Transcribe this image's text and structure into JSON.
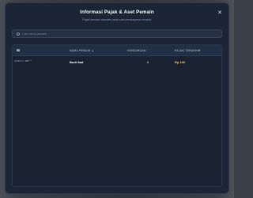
{
  "modal": {
    "title": "Informasi Pajak & Aset Pemain",
    "subtitle": "Pajak tercatat otomatis pada saat pembayaran terakhir"
  },
  "search": {
    "placeholder": "Cari nama pemain..."
  },
  "table": {
    "headers": {
      "name": "NAMA PEMAIN ▲",
      "vehicles": "KENDARAAN",
      "last_tax": "PAJAK TERAKHIR"
    },
    "rows": [
      {
        "id": "char1:a6**",
        "name": "Budi Sad",
        "vehicles": "0",
        "last_tax": "Rp 100"
      }
    ]
  },
  "colors": {
    "accent": "#f5c542",
    "panel": "#1c2535"
  }
}
